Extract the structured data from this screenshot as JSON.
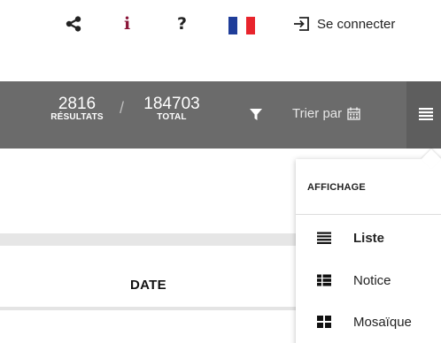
{
  "topbar": {
    "share_icon": "share-icon",
    "info_glyph": "i",
    "help_glyph": "?",
    "flag_colors": [
      "#1f3d99",
      "#ffffff",
      "#e8242c"
    ],
    "login_label": "Se connecter",
    "info_color": "#8a1538"
  },
  "results": {
    "results_count": "2816",
    "results_label": "RÉSULTATS",
    "separator": "/",
    "total_count": "184703",
    "total_label": "TOTAL",
    "sort_label": "Trier par",
    "bar_color": "#6b6b6b"
  },
  "table": {
    "date_header": "DATE"
  },
  "display_menu": {
    "title": "AFFICHAGE",
    "items": [
      {
        "label": "Liste",
        "icon": "list-icon",
        "active": true
      },
      {
        "label": "Notice",
        "icon": "notice-icon",
        "active": false
      },
      {
        "label": "Mosaïque",
        "icon": "mosaic-icon",
        "active": false
      }
    ]
  }
}
